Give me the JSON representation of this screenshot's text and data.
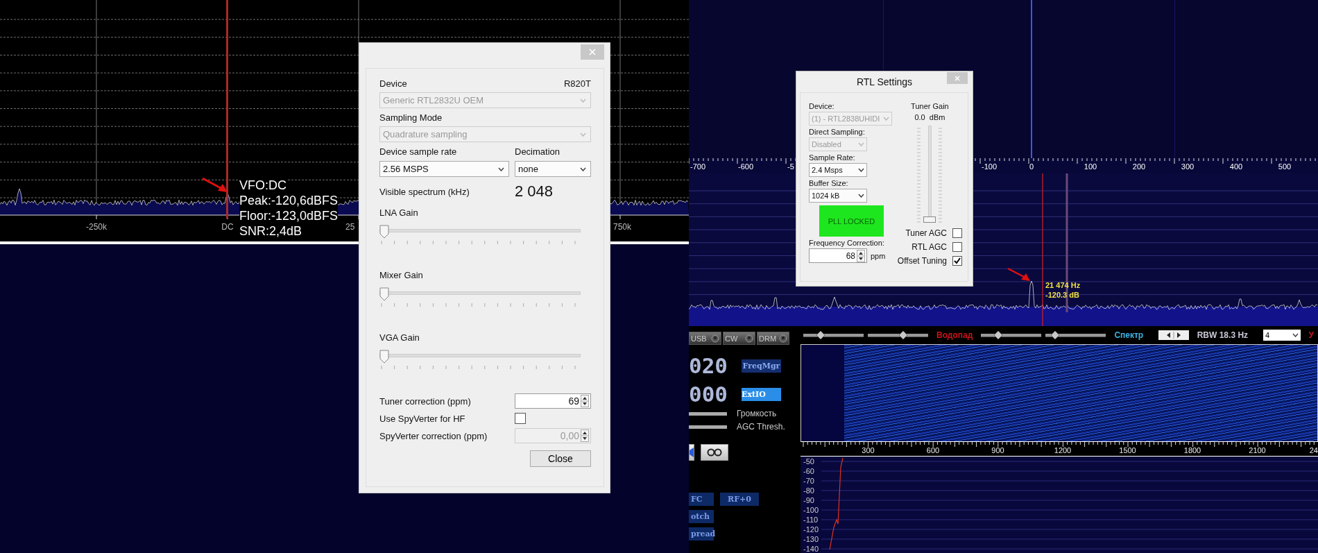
{
  "left_spectrum": {
    "axis_labels": [
      "-250k",
      "DC",
      "25",
      "750k"
    ],
    "readout": [
      "VFO:DC",
      "Peak:-120,6dBFS",
      "Floor:-123,0dBFS",
      "SNR:2,4dB"
    ]
  },
  "device_dialog": {
    "device": {
      "label": "Device",
      "tuner": "R820T",
      "value": "Generic RTL2832U OEM",
      "disabled": true
    },
    "sampling_mode": {
      "label": "Sampling Mode",
      "value": "Quadrature sampling",
      "disabled": true
    },
    "sample_rate": {
      "label": "Device sample rate",
      "value": "2.56 MSPS",
      "disabled": false
    },
    "decimation": {
      "label": "Decimation",
      "value": "none",
      "disabled": false
    },
    "visible_spectrum": {
      "label": "Visible spectrum (kHz)",
      "value": "2 048"
    },
    "gains": [
      {
        "label": "LNA Gain",
        "level": 0
      },
      {
        "label": "Mixer Gain",
        "level": 0
      },
      {
        "label": "VGA Gain",
        "level": 0
      }
    ],
    "tuner_correction": {
      "label": "Tuner correction (ppm)",
      "value": "69",
      "disabled": false
    },
    "spyverter": {
      "label": "Use SpyVerter for HF",
      "checked": false
    },
    "spyverter_correction": {
      "label": "SpyVerter correction (ppm)",
      "value": "0,00",
      "disabled": true
    },
    "close_button": "Close"
  },
  "rtl_settings": {
    "title": "RTL Settings",
    "selects": [
      {
        "label": "Device:",
        "value": "(1) - RTL2838UHIDI",
        "disabled": true
      },
      {
        "label": "Direct Sampling:",
        "value": "Disabled",
        "disabled": true
      },
      {
        "label": "Sample Rate:",
        "value": "2.4 Msps",
        "disabled": false
      },
      {
        "label": "Buffer Size:",
        "value": "1024 kB",
        "disabled": false
      }
    ],
    "pll_status": {
      "text": "PLL LOCKED",
      "locked": true
    },
    "frequency_correction": {
      "label": "Frequency Correction:",
      "value": "68",
      "unit": "ppm"
    },
    "tuner_gain": {
      "label": "Tuner Gain",
      "reading": "0.0  dBm",
      "level": 0
    },
    "checkboxes": [
      {
        "label": "Tuner AGC",
        "checked": false
      },
      {
        "label": "RTL AGC",
        "checked": false
      },
      {
        "label": "Offset Tuning",
        "checked": true
      }
    ]
  },
  "right_spectrum": {
    "axis_labels": [
      "-700",
      "-600",
      "-5",
      "-100",
      "0",
      "100",
      "200",
      "300",
      "400",
      "500"
    ],
    "peak_readout": [
      "21 474 Hz",
      "-120.3 dB"
    ]
  },
  "receiver_panel": {
    "mode_buttons": [
      "USB",
      "CW",
      "DRM"
    ],
    "frequency_digits": [
      "020",
      "000"
    ],
    "buttons": [
      {
        "label": "FreqMgr",
        "selected": false
      },
      {
        "label": "ExtIO",
        "selected": true
      }
    ],
    "slider_labels": [
      "Громкость",
      "AGC Thresh."
    ],
    "side_buttons": [
      "FC",
      "otch",
      "pread"
    ],
    "rf_button": "RF+0"
  },
  "display_toolbar": [
    {
      "kind": "slider",
      "level": 0.25
    },
    {
      "kind": "slider",
      "level": 0.6
    },
    {
      "kind": "label",
      "text": "Водопад",
      "color": "#c8141b"
    },
    {
      "kind": "slider",
      "level": 0.25
    },
    {
      "kind": "slider",
      "level": 0.1
    },
    {
      "kind": "label",
      "text": "Спектр",
      "color": "#3cb4e6"
    },
    {
      "kind": "stepper"
    },
    {
      "kind": "label",
      "text": "RBW 18.3 Hz",
      "color": "#c8c8d8"
    },
    {
      "kind": "dropdown",
      "text": "4"
    },
    {
      "kind": "label",
      "text": "У",
      "color": "#c8141b"
    }
  ],
  "audio_waterfall": {
    "axis_labels": [
      "300",
      "600",
      "900",
      "1200",
      "1500",
      "1800",
      "2100",
      "24"
    ]
  },
  "audio_spectrum": {
    "axis_labels": [
      "-50",
      "-60",
      "-70",
      "-80",
      "-90",
      "-100",
      "-110",
      "-120",
      "-130",
      "-140"
    ]
  }
}
